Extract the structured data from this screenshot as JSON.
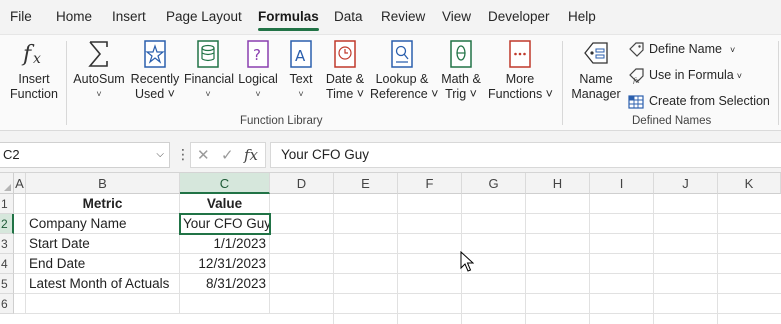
{
  "menu": {
    "tabs": [
      "File",
      "Home",
      "Insert",
      "Page Layout",
      "Formulas",
      "Data",
      "Review",
      "View",
      "Developer",
      "Help"
    ],
    "active": "Formulas"
  },
  "ribbon": {
    "insert_function": [
      "Insert",
      "Function"
    ],
    "function_library": {
      "label": "Function Library",
      "buttons": [
        {
          "l1": "AutoSum",
          "l2": "˅",
          "icon": "sigma-icon"
        },
        {
          "l1": "Recently",
          "l2": "Used ˅",
          "icon": "star-book-icon"
        },
        {
          "l1": "Financial",
          "l2": "˅",
          "icon": "coins-book-icon"
        },
        {
          "l1": "Logical",
          "l2": "˅",
          "icon": "question-book-icon"
        },
        {
          "l1": "Text",
          "l2": "˅",
          "icon": "letter-a-book-icon"
        },
        {
          "l1": "Date &",
          "l2": "Time ˅",
          "icon": "clock-book-icon"
        },
        {
          "l1": "Lookup &",
          "l2": "Reference ˅",
          "icon": "magnifier-book-icon"
        },
        {
          "l1": "Math &",
          "l2": "Trig ˅",
          "icon": "theta-book-icon"
        },
        {
          "l1": "More",
          "l2": "Functions ˅",
          "icon": "dots-book-icon"
        }
      ]
    },
    "defined_names": {
      "label": "Defined Names",
      "name_manager": [
        "Name",
        "Manager"
      ],
      "define_name": "Define Name",
      "use_in_formula": "Use in Formula",
      "create_from_selection": "Create from Selection"
    }
  },
  "formula_bar": {
    "name_box": "C2",
    "fx": "fx",
    "cancel": "✕",
    "enter": "✓",
    "value": "Your CFO Guy"
  },
  "sheet": {
    "columns": [
      "A",
      "B",
      "C",
      "D",
      "E",
      "F",
      "G",
      "H",
      "I",
      "J",
      "K"
    ],
    "selected_column": "C",
    "rows": [
      "1",
      "2",
      "3",
      "4",
      "5",
      "6"
    ],
    "selected_row": "2",
    "cells": {
      "B1": "Metric",
      "C1": "Value",
      "B2": "Company Name",
      "C2": "Your CFO Guy",
      "B3": "Start Date",
      "C3": "1/1/2023",
      "B4": "End Date",
      "C4": "12/31/2023",
      "B5": "Latest Month of Actuals",
      "C5": "8/31/2023"
    },
    "active_cell": "C2"
  },
  "colors": {
    "accent": "#217346",
    "selection_header": "#d6e7dc"
  }
}
